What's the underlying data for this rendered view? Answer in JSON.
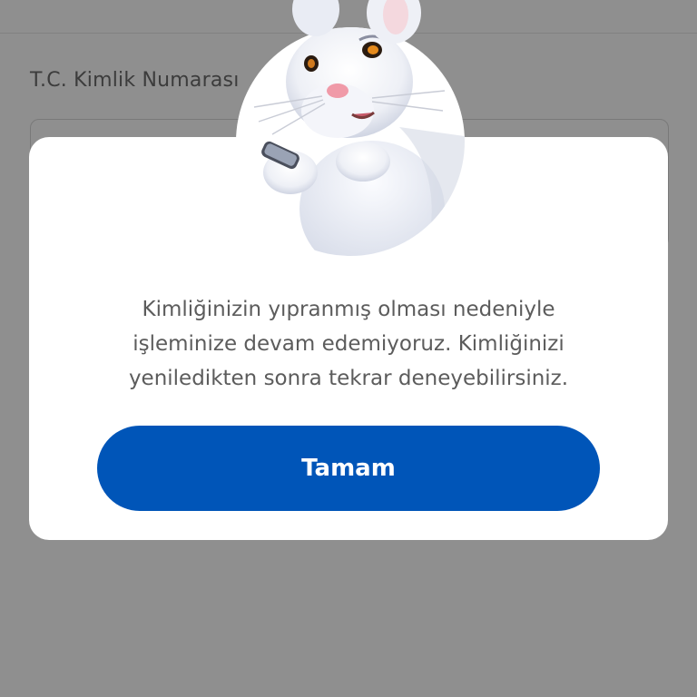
{
  "form": {
    "field_label": "T.C. Kimlik Numarası",
    "field_value": ""
  },
  "dialog": {
    "mascot": "white-rabbit-holding-phone-illustration",
    "message_lines": [
      "Kimliğinizin yıpranmış olması nedeniyle",
      "işleminize devam edemiyoruz. Kimliğinizi",
      "yeniledikten sonra tekrar deneyebilirsiniz."
    ],
    "ok_label": "Tamam"
  },
  "colors": {
    "primary_button": "#0055b8",
    "overlay": "rgba(0,0,0,0.44)",
    "message_text": "#5c5c5c",
    "dialog_bg": "#ffffff"
  }
}
